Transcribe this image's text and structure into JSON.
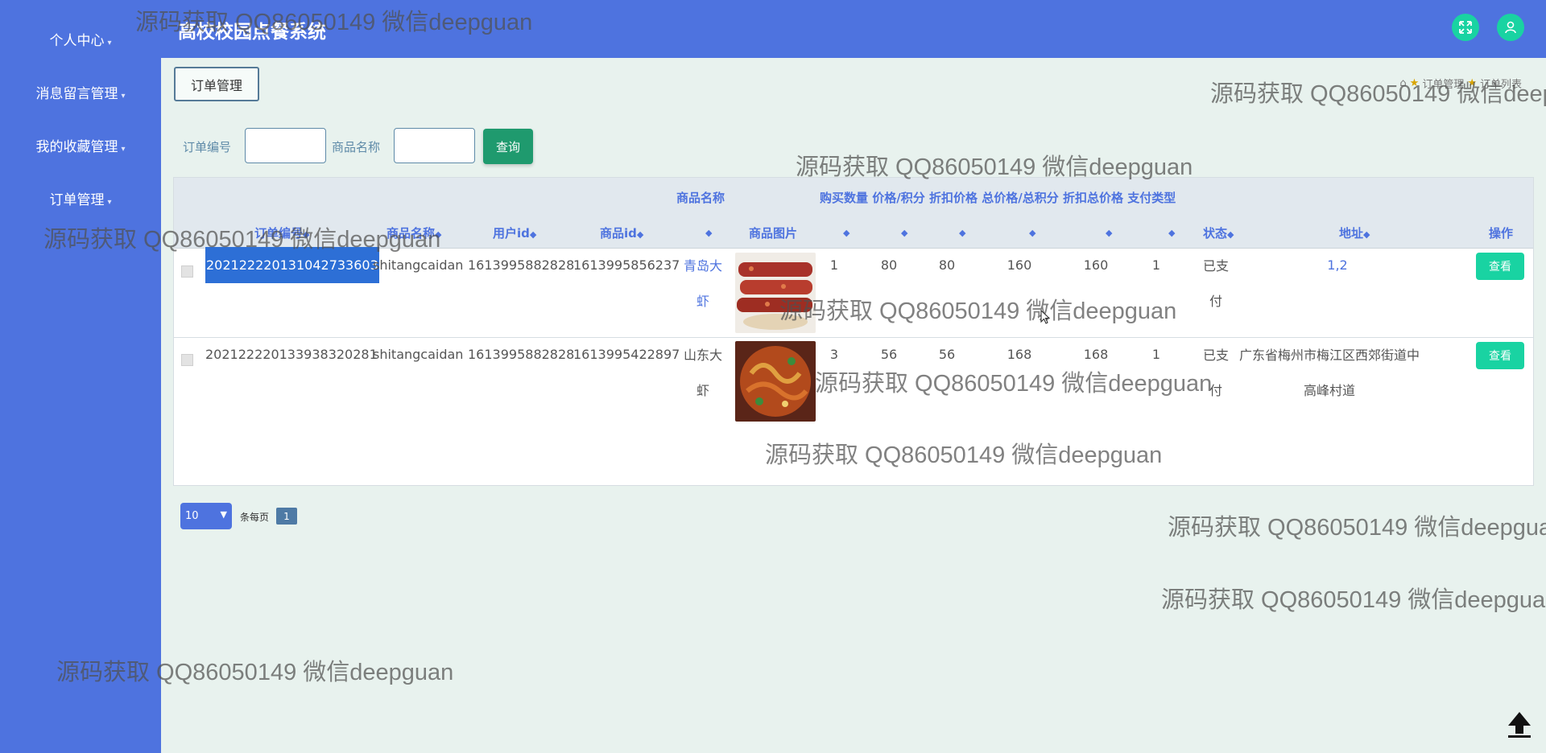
{
  "app": {
    "title": "高校校园点餐系统"
  },
  "sidebar": {
    "items": [
      {
        "label": "个人中心"
      },
      {
        "label": "消息留言管理"
      },
      {
        "label": "我的收藏管理"
      },
      {
        "label": "订单管理"
      }
    ]
  },
  "header": {
    "fullscreen_icon": "expand-icon",
    "user_icon": "user-icon"
  },
  "page": {
    "tab": "订单管理",
    "breadcrumb": [
      "订单管理",
      "订单列表"
    ]
  },
  "search": {
    "order_no_label": "订单编号",
    "order_no_value": "",
    "goods_name_label": "商品名称",
    "goods_name_value": "",
    "button": "查询"
  },
  "table": {
    "header_top_goods_name": "商品名称",
    "header_top_group": [
      "购买数量",
      "价格/积分",
      "折扣价格",
      "总价格/总积分",
      "折扣总价格",
      "支付类型"
    ],
    "columns": [
      "订单编号",
      "商品名称",
      "用户id",
      "商品id",
      "商品图片",
      "状态",
      "地址",
      "操作"
    ],
    "rows": [
      {
        "order_no": "20212222013104273360​3",
        "table_name": "shitangcaidan",
        "user_id": "1613995882828",
        "goods_id": "1613995856237",
        "goods_name": "青岛大虾",
        "qty": "1",
        "price": "80",
        "discount_price": "80",
        "total": "160",
        "discount_total": "160",
        "pay_type": "1",
        "status": "已支付",
        "address": "1,2",
        "action": "查看"
      },
      {
        "order_no": "20212222013393832028​1",
        "table_name": "shitangcaidan",
        "user_id": "1613995882828",
        "goods_id": "1613995422897",
        "goods_name": "山东大虾",
        "qty": "3",
        "price": "56",
        "discount_price": "56",
        "total": "168",
        "discount_total": "168",
        "pay_type": "1",
        "status": "已支付",
        "address": "广东省梅州市梅江区西郊街道中高峰村道",
        "action": "查看"
      }
    ]
  },
  "pagination": {
    "page_size": "10",
    "per_page_text": "条每页",
    "current_page": "1"
  },
  "watermark": "源码获取 QQ86050149 微信deepguan",
  "colors": {
    "primary": "#4e73df",
    "accent": "#19d3a2",
    "search_button": "#1f9a6e",
    "background": "#e8f2ee"
  }
}
